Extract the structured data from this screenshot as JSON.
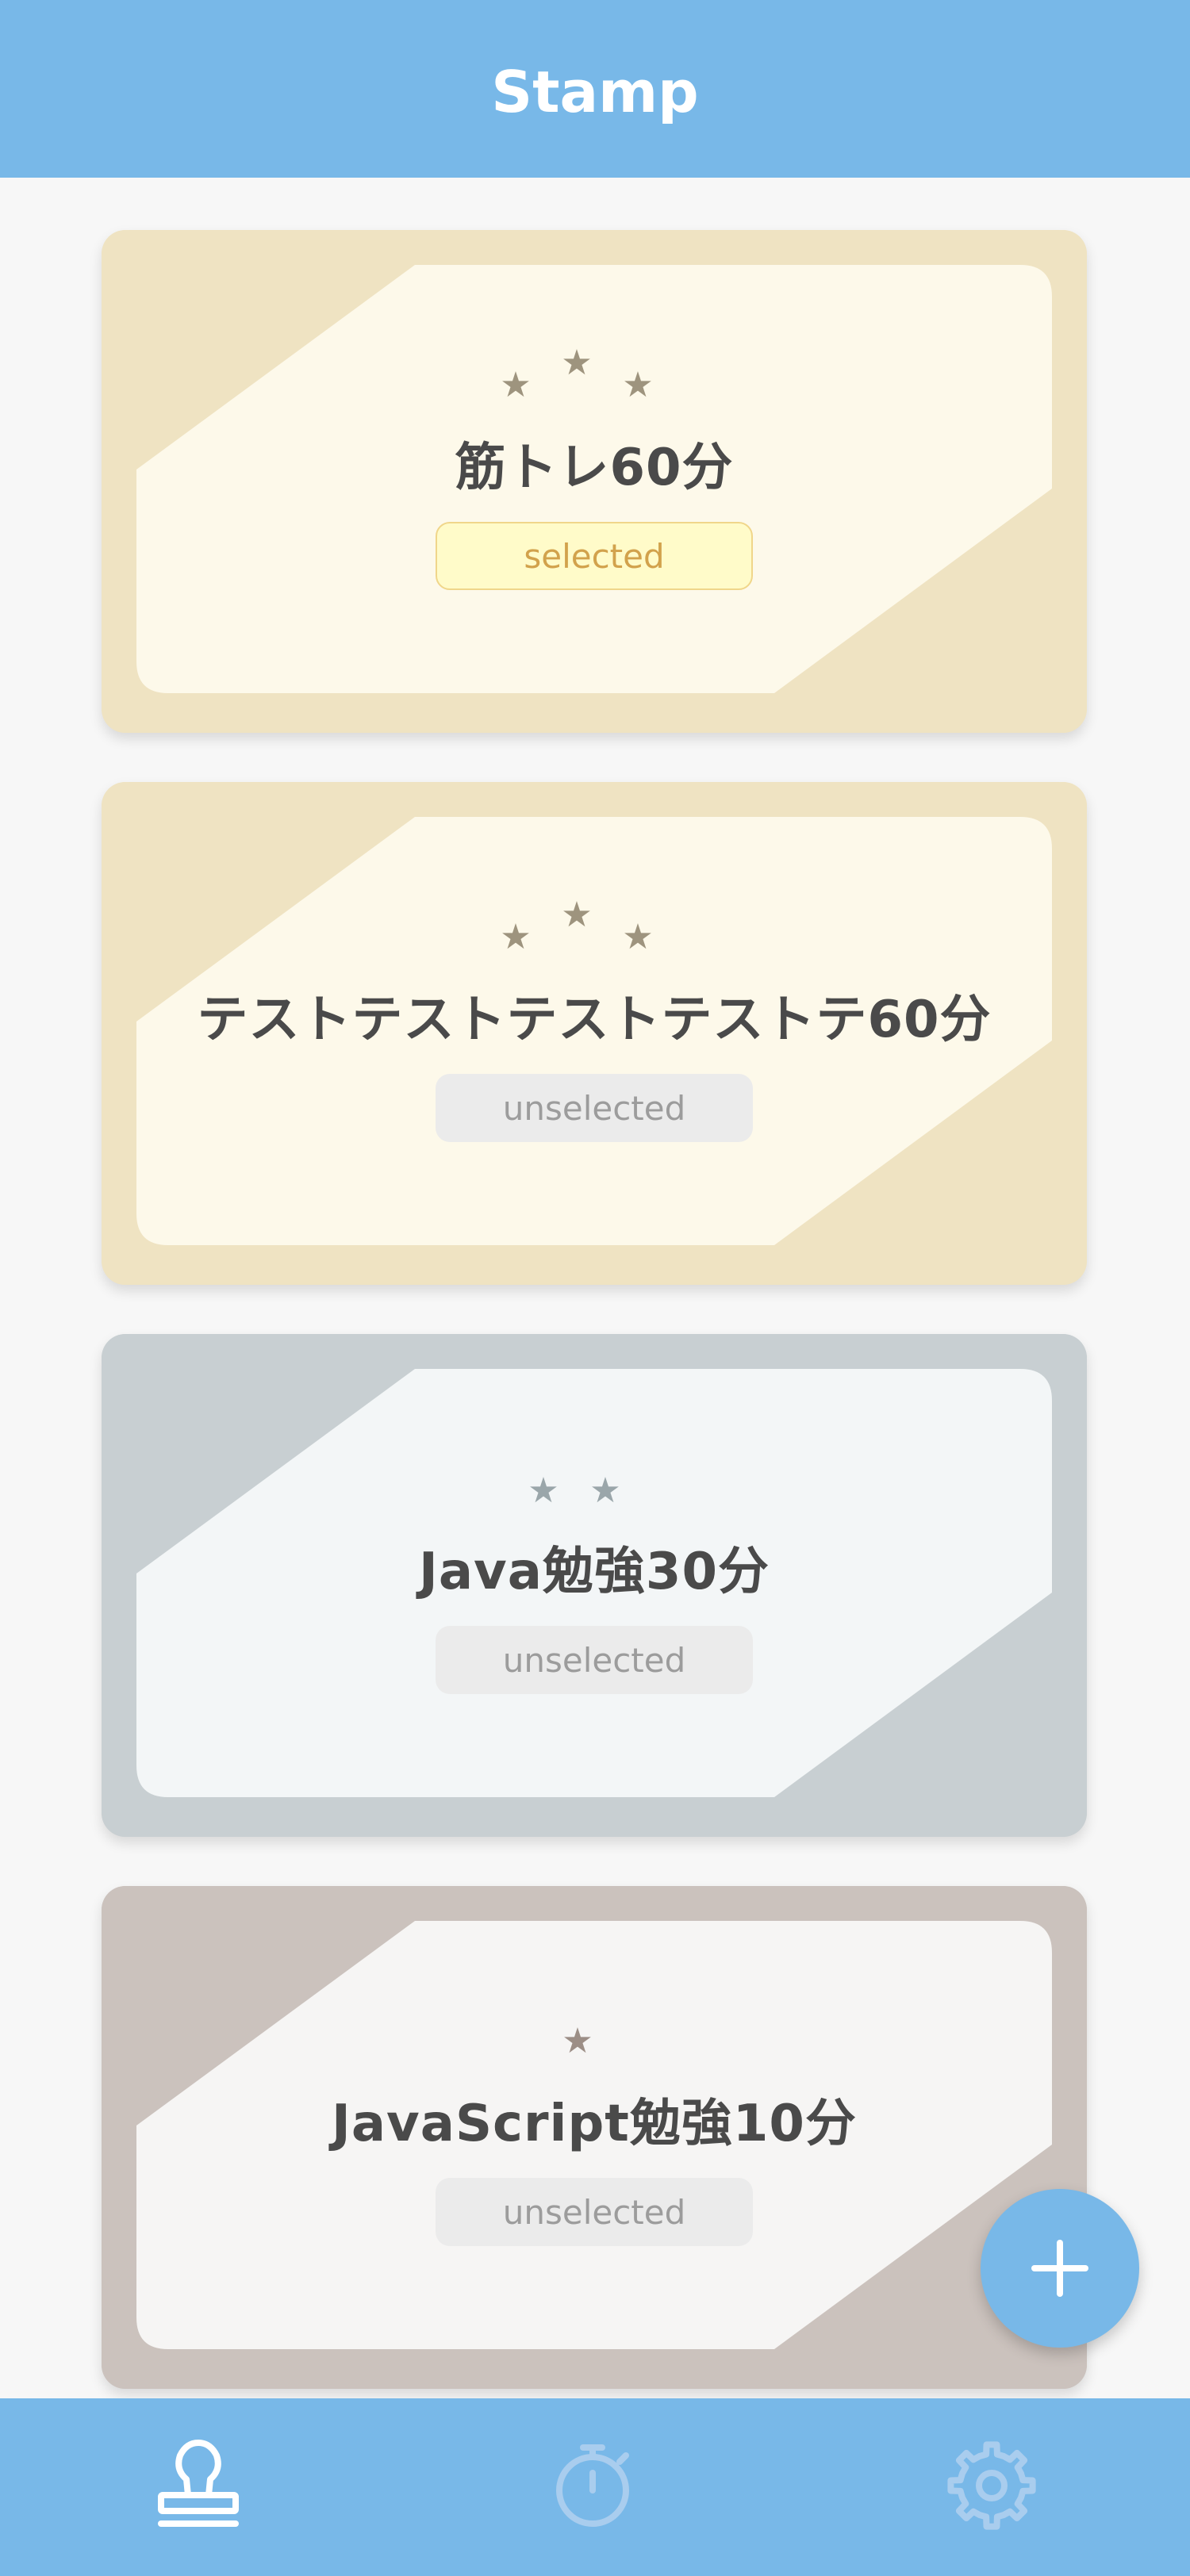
{
  "header": {
    "title": "Stamp"
  },
  "cards": [
    {
      "title": "筋トレ60分",
      "stars": 3,
      "status": "selected",
      "colors": {
        "frame": "#efe3c2",
        "panel": "#fdf9ea",
        "star": "#9e947e"
      }
    },
    {
      "title": "テストテストテストテストテ60分",
      "stars": 3,
      "status": "unselected",
      "colors": {
        "frame": "#efe3c2",
        "panel": "#fdf9ea",
        "star": "#9e947e"
      }
    },
    {
      "title": "Java勉強30分",
      "stars": 2,
      "status": "unselected",
      "colors": {
        "frame": "#c8cfd2",
        "panel": "#f3f6f7",
        "star": "#9aa6aa"
      }
    },
    {
      "title": "JavaScript勉強10分",
      "stars": 1,
      "status": "unselected",
      "colors": {
        "frame": "#cbc2bd",
        "panel": "#f6f5f4",
        "star": "#9c8e86"
      }
    }
  ],
  "fab": {
    "icon": "plus-icon"
  },
  "tabbar": {
    "items": [
      {
        "icon": "stamp-icon",
        "active": true
      },
      {
        "icon": "timer-icon",
        "active": false
      },
      {
        "icon": "gear-icon",
        "active": false
      }
    ],
    "colors": {
      "active": "#ffffff",
      "inactive": "#a9cdee"
    }
  },
  "colors": {
    "accent": "#78b8e8",
    "background": "#f7f7f7"
  }
}
